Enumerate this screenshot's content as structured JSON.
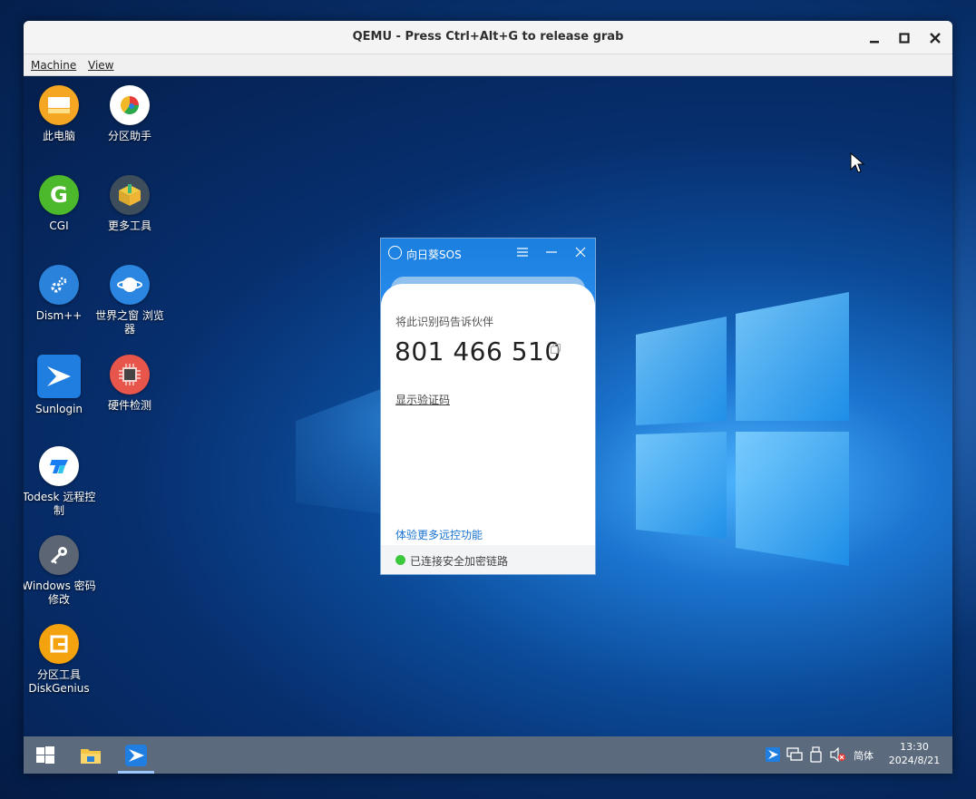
{
  "qemu": {
    "title": "QEMU - Press Ctrl+Alt+G to release grab",
    "menus": [
      "Machine",
      "View"
    ],
    "buttons": {
      "minimize": "minimize-icon",
      "maximize": "maximize-icon",
      "close": "close-icon"
    }
  },
  "desktop_icons": [
    {
      "label": "此电脑",
      "icon": "this-pc-icon"
    },
    {
      "label": "分区助手",
      "icon": "partition-assistant-icon"
    },
    {
      "label": "CGI",
      "icon": "cgi-icon"
    },
    {
      "label": "更多工具",
      "icon": "more-tools-icon"
    },
    {
      "label": "Dism++",
      "icon": "dism-icon"
    },
    {
      "label": "世界之窗 浏览器",
      "icon": "browser-icon"
    },
    {
      "label": "Sunlogin",
      "icon": "sunlogin-icon"
    },
    {
      "label": "硬件检测",
      "icon": "hardware-check-icon"
    },
    {
      "label": "Todesk 远程控制",
      "icon": "todesk-icon"
    },
    {
      "label": "Windows 密码修改",
      "icon": "key-icon"
    },
    {
      "label": "分区工具 DiskGenius",
      "icon": "diskgenius-icon"
    }
  ],
  "sos_window": {
    "title": "向日葵SOS",
    "prompt": "将此识别码告诉伙伴",
    "code": "801 466 510",
    "show_code_link": "显示验证码",
    "more_link": "体验更多远控功能",
    "status": "已连接安全加密链路",
    "status_color": "#3cc83c",
    "accent": "#1b7fe0"
  },
  "taskbar": {
    "apps": [
      "start-icon",
      "file-explorer-icon",
      "sunlogin-taskbar-icon"
    ],
    "tray": [
      "sunlogin-tray-icon",
      "network-icon",
      "usb-icon",
      "volume-muted-icon"
    ],
    "ime": "简体",
    "time": "13:30",
    "date": "2024/8/21"
  }
}
